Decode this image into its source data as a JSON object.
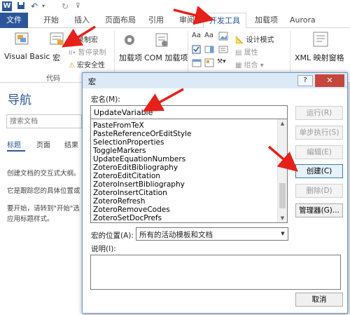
{
  "tabs": [
    "文件",
    "开始",
    "插入",
    "页面布局",
    "引用",
    "审阅",
    "开发工具",
    "加载项",
    "Aurora"
  ],
  "ribbon": {
    "visual_basic": "Visual Basic",
    "macros": "宏",
    "record_macro": "录制宏",
    "pause_recording": "暂停录制",
    "macro_security": "宏安全性",
    "code_group": "代码",
    "addins": "加载项",
    "com_addins": "COM 加载项",
    "design_mode": "设计模式",
    "properties": "属性",
    "group": "组合",
    "xml_mapping": "XML 映射窗格"
  },
  "nav": {
    "title": "导航",
    "search_placeholder": "搜索文档",
    "tab_headings": "标题",
    "tab_pages": "页面",
    "tab_results": "结果",
    "line1": "创建文档的交互式大纲。",
    "line2": "它是跟踪您的具体位置或",
    "line3": "要开始，请转到\"开始\"选",
    "line4": "应用标题样式。"
  },
  "dialog": {
    "title": "宏",
    "help": "?",
    "close": "✕",
    "macro_name_label": "宏名(M):",
    "macro_name_value": "UpdateVariable",
    "macro_list": [
      "PasteFromTeX",
      "PasteReferenceOrEditStyle",
      "SelectionProperties",
      "ToggleMarkers",
      "UpdateEquationNumbers",
      "ZoteroEditBibliography",
      "ZoteroEditCitation",
      "ZoteroInsertBibliography",
      "ZoteroInsertCitation",
      "ZoteroRefresh",
      "ZoteroRemoveCodes",
      "ZoteroSetDocPrefs"
    ],
    "location_label": "宏的位置(A):",
    "location_value": "所有的活动模板和文档",
    "description_label": "说明(I):",
    "buttons": {
      "run": "运行(R)",
      "step_into": "单步执行(S)",
      "edit": "编辑(E)",
      "create": "创建(C)",
      "delete": "删除(D)",
      "organizer": "管理器(G)...",
      "cancel": "取消"
    }
  },
  "colors": {
    "word_blue": "#2b579a",
    "arrow_red": "#e5211a"
  }
}
